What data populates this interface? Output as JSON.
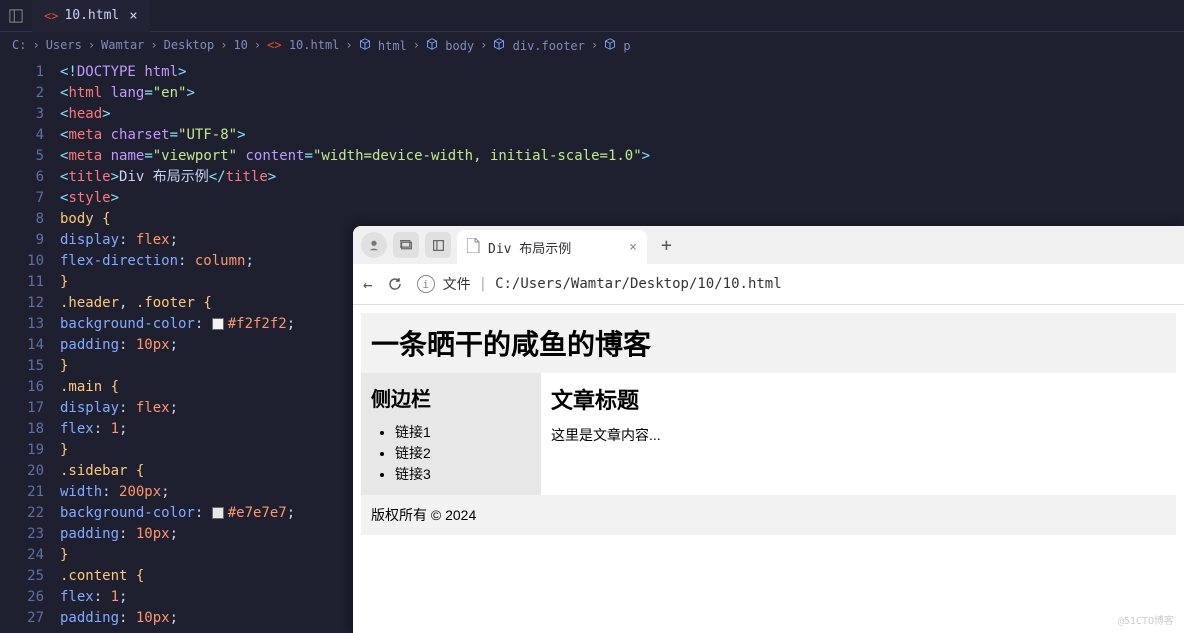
{
  "editor": {
    "tab": {
      "filename": "10.html"
    },
    "breadcrumbs": [
      "C:",
      "Users",
      "Wamtar",
      "Desktop",
      "10",
      "10.html",
      "html",
      "body",
      "div.footer",
      "p"
    ],
    "code": [
      {
        "n": 1,
        "tokens": [
          [
            "<!",
            "punc"
          ],
          [
            "DOCTYPE",
            "doctype"
          ],
          [
            " ",
            "def"
          ],
          [
            "html",
            "attr"
          ],
          [
            ">",
            "punc"
          ]
        ]
      },
      {
        "n": 2,
        "tokens": [
          [
            "<",
            "punc"
          ],
          [
            "html",
            "tag"
          ],
          [
            " ",
            "def"
          ],
          [
            "lang",
            "attr"
          ],
          [
            "=",
            "punc"
          ],
          [
            "\"en\"",
            "str"
          ],
          [
            ">",
            "punc"
          ]
        ]
      },
      {
        "n": 3,
        "tokens": [
          [
            "<",
            "punc"
          ],
          [
            "head",
            "tag"
          ],
          [
            ">",
            "punc"
          ]
        ]
      },
      {
        "n": 4,
        "tokens": [
          [
            "<",
            "punc"
          ],
          [
            "meta",
            "tag"
          ],
          [
            " ",
            "def"
          ],
          [
            "charset",
            "attr"
          ],
          [
            "=",
            "punc"
          ],
          [
            "\"UTF-8\"",
            "str"
          ],
          [
            ">",
            "punc"
          ]
        ]
      },
      {
        "n": 5,
        "tokens": [
          [
            "<",
            "punc"
          ],
          [
            "meta",
            "tag"
          ],
          [
            " ",
            "def"
          ],
          [
            "name",
            "attr"
          ],
          [
            "=",
            "punc"
          ],
          [
            "\"viewport\"",
            "str"
          ],
          [
            " ",
            "def"
          ],
          [
            "content",
            "attr"
          ],
          [
            "=",
            "punc"
          ],
          [
            "\"width=device-width, initial-scale=1.0\"",
            "str"
          ],
          [
            ">",
            "punc"
          ]
        ]
      },
      {
        "n": 6,
        "tokens": [
          [
            "<",
            "punc"
          ],
          [
            "title",
            "tag"
          ],
          [
            ">",
            "punc"
          ],
          [
            "Div 布局示例",
            "def"
          ],
          [
            "</",
            "punc"
          ],
          [
            "title",
            "tag"
          ],
          [
            ">",
            "punc"
          ]
        ]
      },
      {
        "n": 7,
        "tokens": [
          [
            "<",
            "punc"
          ],
          [
            "style",
            "tag"
          ],
          [
            ">",
            "punc"
          ]
        ]
      },
      {
        "n": 8,
        "tokens": [
          [
            "body",
            "sel"
          ],
          [
            " {",
            "brace"
          ]
        ]
      },
      {
        "n": 9,
        "tokens": [
          [
            "display",
            "prop"
          ],
          [
            ": ",
            "def"
          ],
          [
            "flex",
            "val"
          ],
          [
            ";",
            "def"
          ]
        ]
      },
      {
        "n": 10,
        "tokens": [
          [
            "flex-direction",
            "prop"
          ],
          [
            ": ",
            "def"
          ],
          [
            "column",
            "val"
          ],
          [
            ";",
            "def"
          ]
        ]
      },
      {
        "n": 11,
        "tokens": [
          [
            "}",
            "brace"
          ]
        ]
      },
      {
        "n": 12,
        "tokens": [
          [
            ".header",
            "sel"
          ],
          [
            ", ",
            "def"
          ],
          [
            ".footer",
            "sel"
          ],
          [
            " {",
            "brace"
          ]
        ]
      },
      {
        "n": 13,
        "tokens": [
          [
            "background-color",
            "prop"
          ],
          [
            ": ",
            "def"
          ]
        ],
        "swatch": "#f2f2f2",
        "after": [
          [
            "#f2f2f2",
            "val"
          ],
          [
            ";",
            "def"
          ]
        ]
      },
      {
        "n": 14,
        "tokens": [
          [
            "padding",
            "prop"
          ],
          [
            ": ",
            "def"
          ],
          [
            "10px",
            "num"
          ],
          [
            ";",
            "def"
          ]
        ]
      },
      {
        "n": 15,
        "tokens": [
          [
            "}",
            "brace"
          ]
        ]
      },
      {
        "n": 16,
        "tokens": [
          [
            ".main",
            "sel"
          ],
          [
            " {",
            "brace"
          ]
        ]
      },
      {
        "n": 17,
        "tokens": [
          [
            "display",
            "prop"
          ],
          [
            ": ",
            "def"
          ],
          [
            "flex",
            "val"
          ],
          [
            ";",
            "def"
          ]
        ]
      },
      {
        "n": 18,
        "tokens": [
          [
            "flex",
            "prop"
          ],
          [
            ": ",
            "def"
          ],
          [
            "1",
            "num"
          ],
          [
            ";",
            "def"
          ]
        ]
      },
      {
        "n": 19,
        "tokens": [
          [
            "}",
            "brace"
          ]
        ]
      },
      {
        "n": 20,
        "tokens": [
          [
            ".sidebar",
            "sel"
          ],
          [
            " {",
            "brace"
          ]
        ]
      },
      {
        "n": 21,
        "tokens": [
          [
            "width",
            "prop"
          ],
          [
            ": ",
            "def"
          ],
          [
            "200px",
            "num"
          ],
          [
            ";",
            "def"
          ]
        ]
      },
      {
        "n": 22,
        "tokens": [
          [
            "background-color",
            "prop"
          ],
          [
            ": ",
            "def"
          ]
        ],
        "swatch": "#e7e7e7",
        "after": [
          [
            "#e7e7e7",
            "val"
          ],
          [
            ";",
            "def"
          ]
        ]
      },
      {
        "n": 23,
        "tokens": [
          [
            "padding",
            "prop"
          ],
          [
            ": ",
            "def"
          ],
          [
            "10px",
            "num"
          ],
          [
            ";",
            "def"
          ]
        ]
      },
      {
        "n": 24,
        "tokens": [
          [
            "}",
            "brace"
          ]
        ]
      },
      {
        "n": 25,
        "tokens": [
          [
            ".content",
            "sel"
          ],
          [
            " {",
            "brace"
          ]
        ]
      },
      {
        "n": 26,
        "tokens": [
          [
            "flex",
            "prop"
          ],
          [
            ": ",
            "def"
          ],
          [
            "1",
            "num"
          ],
          [
            ";",
            "def"
          ]
        ]
      },
      {
        "n": 27,
        "tokens": [
          [
            "padding",
            "prop"
          ],
          [
            ": ",
            "def"
          ],
          [
            "10px",
            "num"
          ],
          [
            ";",
            "def"
          ]
        ]
      }
    ]
  },
  "browser": {
    "tab_title": "Div 布局示例",
    "addr_label": "文件",
    "addr_path": "C:/Users/Wamtar/Desktop/10/10.html",
    "page": {
      "header_title": "一条晒干的咸鱼的博客",
      "sidebar_title": "侧边栏",
      "sidebar_links": [
        "链接1",
        "链接2",
        "链接3"
      ],
      "content_title": "文章标题",
      "content_body": "这里是文章内容...",
      "footer_text": "版权所有 © 2024"
    }
  },
  "watermark": "@51CTO博客"
}
